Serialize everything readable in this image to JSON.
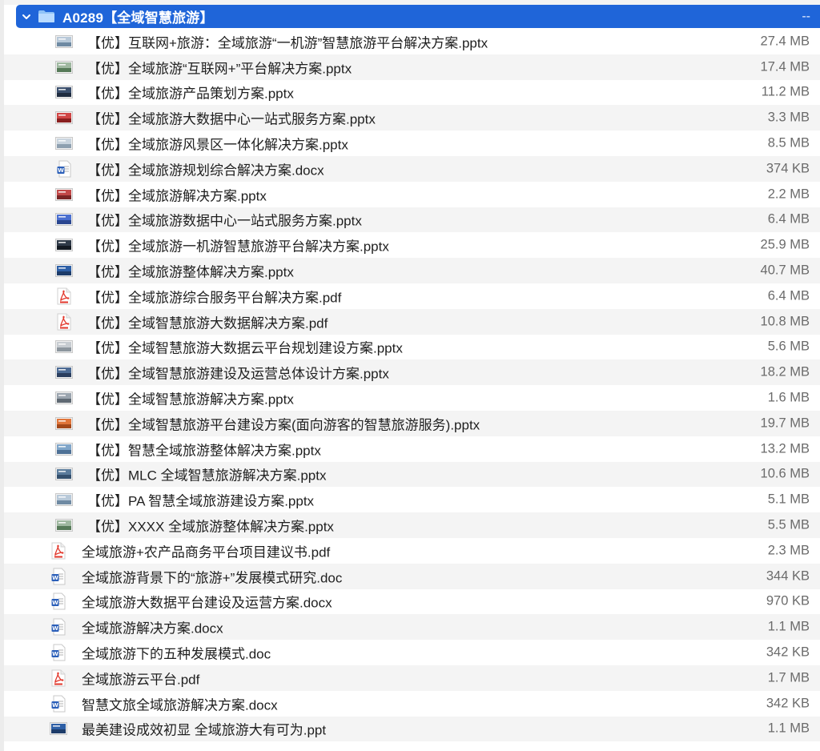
{
  "folder": {
    "name": "A0289【全域智慧旅游】",
    "size": "--",
    "icon": "folder-icon",
    "accent": "#1f65d9"
  },
  "files": [
    {
      "name": "【优】互联网+旅游：全域旅游“一机游”智慧旅游平台解决方案.pptx",
      "size": "27.4 MB",
      "type": "pptx",
      "indent": 1
    },
    {
      "name": "【优】全域旅游“互联网+”平台解决方案.pptx",
      "size": "17.4 MB",
      "type": "pptx",
      "indent": 1
    },
    {
      "name": "【优】全域旅游产品策划方案.pptx",
      "size": "11.2 MB",
      "type": "pptx",
      "indent": 1
    },
    {
      "name": "【优】全域旅游大数据中心一站式服务方案.pptx",
      "size": "3.3 MB",
      "type": "pptx",
      "indent": 1
    },
    {
      "name": "【优】全域旅游风景区一体化解决方案.pptx",
      "size": "8.5 MB",
      "type": "pptx",
      "indent": 1
    },
    {
      "name": "【优】全域旅游规划综合解决方案.docx",
      "size": "374 KB",
      "type": "docx",
      "indent": 1
    },
    {
      "name": "【优】全域旅游解决方案.pptx",
      "size": "2.2 MB",
      "type": "pptx",
      "indent": 1
    },
    {
      "name": "【优】全域旅游数据中心一站式服务方案.pptx",
      "size": "6.4 MB",
      "type": "pptx",
      "indent": 1
    },
    {
      "name": "【优】全域旅游一机游智慧旅游平台解决方案.pptx",
      "size": "25.9 MB",
      "type": "pptx",
      "indent": 1
    },
    {
      "name": "【优】全域旅游整体解决方案.pptx",
      "size": "40.7 MB",
      "type": "pptx",
      "indent": 1
    },
    {
      "name": "【优】全域旅游综合服务平台解决方案.pdf",
      "size": "6.4 MB",
      "type": "pdf",
      "indent": 1
    },
    {
      "name": "【优】全域智慧旅游大数据解决方案.pdf",
      "size": "10.8 MB",
      "type": "pdf",
      "indent": 1
    },
    {
      "name": "【优】全域智慧旅游大数据云平台规划建设方案.pptx",
      "size": "5.6 MB",
      "type": "pptx",
      "indent": 1
    },
    {
      "name": "【优】全域智慧旅游建设及运营总体设计方案.pptx",
      "size": "18.2 MB",
      "type": "pptx",
      "indent": 1
    },
    {
      "name": "【优】全域智慧旅游解决方案.pptx",
      "size": "1.6 MB",
      "type": "pptx",
      "indent": 1
    },
    {
      "name": "【优】全域智慧旅游平台建设方案(面向游客的智慧旅游服务).pptx",
      "size": "19.7 MB",
      "type": "pptx",
      "indent": 1
    },
    {
      "name": "【优】智慧全域旅游整体解决方案.pptx",
      "size": "13.2 MB",
      "type": "pptx",
      "indent": 1
    },
    {
      "name": "【优】MLC 全域智慧旅游解决方案.pptx",
      "size": "10.6 MB",
      "type": "pptx",
      "indent": 1
    },
    {
      "name": "【优】PA 智慧全域旅游建设方案.pptx",
      "size": "5.1 MB",
      "type": "pptx",
      "indent": 1
    },
    {
      "name": "【优】XXXX 全域旅游整体解决方案.pptx",
      "size": "5.5 MB",
      "type": "pptx",
      "indent": 1
    },
    {
      "name": "全域旅游+农产品商务平台项目建议书.pdf",
      "size": "2.3 MB",
      "type": "pdf",
      "indent": 0
    },
    {
      "name": "全域旅游背景下的“旅游+”发展模式研究.doc",
      "size": "344 KB",
      "type": "doc",
      "indent": 0
    },
    {
      "name": "全域旅游大数据平台建设及运营方案.docx",
      "size": "970 KB",
      "type": "docx",
      "indent": 0
    },
    {
      "name": "全域旅游解决方案.docx",
      "size": "1.1 MB",
      "type": "docx",
      "indent": 0
    },
    {
      "name": "全域旅游下的五种发展模式.doc",
      "size": "342 KB",
      "type": "doc",
      "indent": 0
    },
    {
      "name": "全域旅游云平台.pdf",
      "size": "1.7 MB",
      "type": "pdf",
      "indent": 0
    },
    {
      "name": "智慧文旅全域旅游解决方案.docx",
      "size": "342 KB",
      "type": "docx",
      "indent": 0
    },
    {
      "name": "最美建设成效初显 全域旅游大有可为.ppt",
      "size": "1.1 MB",
      "type": "ppt",
      "indent": 0
    }
  ]
}
